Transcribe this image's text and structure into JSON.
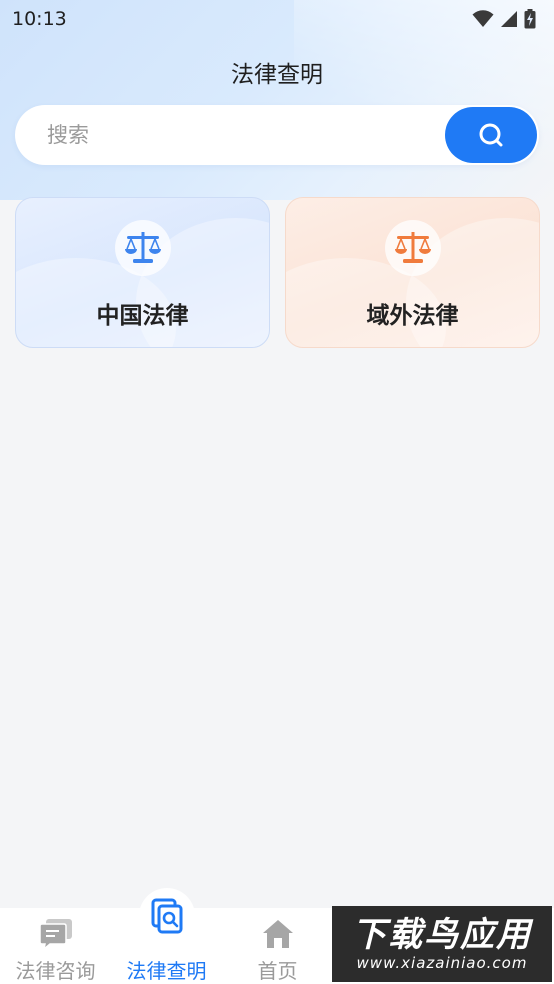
{
  "status": {
    "time": "10:13"
  },
  "header": {
    "title": "法律查明"
  },
  "search": {
    "placeholder": "搜索"
  },
  "cards": [
    {
      "label": "中国法律",
      "accent": "#3d84ee"
    },
    {
      "label": "域外法律",
      "accent": "#f07b3c"
    }
  ],
  "tabs": [
    {
      "label": "法律咨询",
      "icon": "chat-icon",
      "active": false
    },
    {
      "label": "法律查明",
      "icon": "document-search-icon",
      "active": true
    },
    {
      "label": "首页",
      "icon": "home-icon",
      "active": false
    }
  ],
  "watermark": {
    "title": "下载鸟应用",
    "url": "www.xiazainiao.com"
  },
  "colors": {
    "primary": "#1f7af5",
    "inactive": "#9a9a9a",
    "background": "#f4f5f7"
  }
}
